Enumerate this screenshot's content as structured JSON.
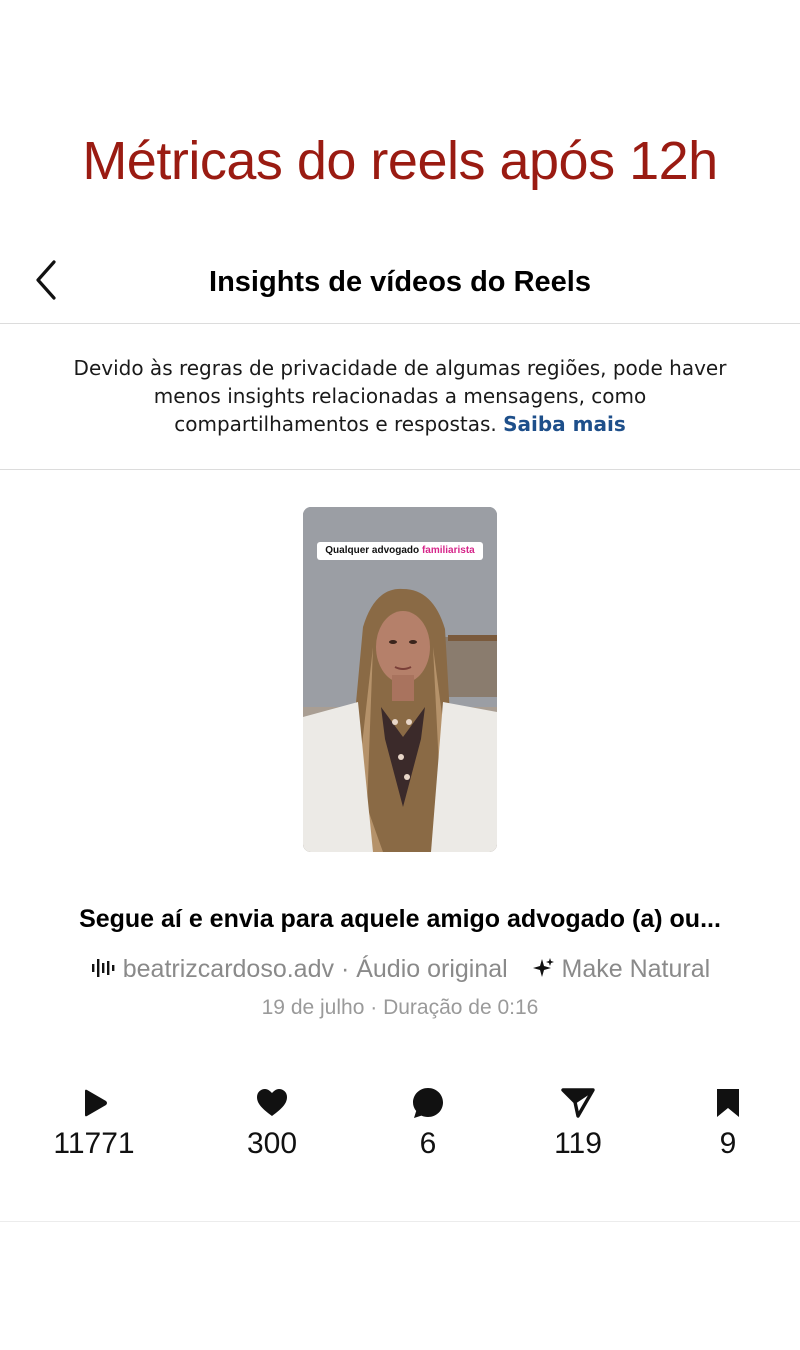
{
  "headline": "Métricas do reels após 12h",
  "topbar": {
    "title": "Insights de vídeos do Reels",
    "back_icon": "chevron-left-icon"
  },
  "notice": {
    "text": "Devido às regras de privacidade de algumas regiões, pode haver menos insights relacionadas a mensagens, como compartilhamentos e respostas.",
    "link": "Saiba mais",
    "link_color": "#1e4f8a"
  },
  "reel": {
    "thumbnail_caption_prefix": "Qualquer advogado",
    "thumbnail_caption_highlight": "familiarista",
    "caption": "Segue aí e envia para aquele amigo advogado (a) ou...",
    "account": "beatrizcardoso.adv",
    "separator": "·",
    "audio": "Áudio original",
    "effect": "Make Natural",
    "date": "19 de julho",
    "duration": "Duração de 0:16"
  },
  "stats": [
    {
      "icon": "play-icon",
      "value": "11771"
    },
    {
      "icon": "heart-icon",
      "value": "300"
    },
    {
      "icon": "comment-icon",
      "value": "6"
    },
    {
      "icon": "share-icon",
      "value": "119"
    },
    {
      "icon": "save-icon",
      "value": "9"
    }
  ],
  "colors": {
    "headline": "#9a1b12",
    "muted": "#8a8a8a",
    "link": "#1e4f8a"
  }
}
